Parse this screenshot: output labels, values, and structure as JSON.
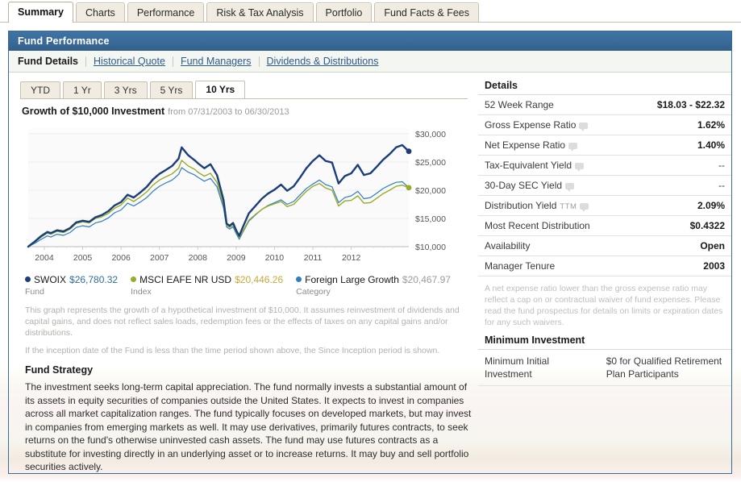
{
  "tabs": [
    {
      "label": "Summary",
      "active": true
    },
    {
      "label": "Charts",
      "active": false
    },
    {
      "label": "Performance",
      "active": false
    },
    {
      "label": "Risk & Tax Analysis",
      "active": false
    },
    {
      "label": "Portfolio",
      "active": false
    },
    {
      "label": "Fund Facts & Fees",
      "active": false
    }
  ],
  "panel": {
    "title": "Fund Performance",
    "subnav": [
      {
        "label": "Fund Details",
        "current": true
      },
      {
        "label": "Historical Quote",
        "current": false
      },
      {
        "label": "Fund Managers",
        "current": false
      },
      {
        "label": "Dividends & Distributions",
        "current": false
      }
    ]
  },
  "periods": [
    {
      "label": "YTD",
      "active": false
    },
    {
      "label": "1 Yr",
      "active": false
    },
    {
      "label": "3 Yrs",
      "active": false
    },
    {
      "label": "5 Yrs",
      "active": false
    },
    {
      "label": "10 Yrs",
      "active": true
    }
  ],
  "chart_header": {
    "title": "Growth of $10,000 Investment",
    "range": "from 07/31/2003 to 06/30/2013"
  },
  "legend": [
    {
      "name": "SWOIX",
      "value": "$26,780.32",
      "sub": "Fund",
      "color": "#1b3d7a",
      "value_color": "#2e6da4"
    },
    {
      "name": "MSCI EAFE NR USD",
      "value": "$20,446.26",
      "sub": "Index",
      "color": "#9aab29",
      "value_color": "#c5a93b"
    },
    {
      "name": "Foreign Large Growth",
      "value": "$20,467.97",
      "sub": "Category",
      "color": "#2f7ec4",
      "value_color": "#9b9b9b"
    }
  ],
  "graph_disclaimer": [
    "This graph represents the growth of a hypothetical investment of $10,000. It assumes reinvestment of dividends and capital gains, and does not reflect sales loads, redemption fees or the effects of taxes on any capital gains and/or distributions.",
    "If the inception date of the Fund is less than the time period shown above, the Since Inception period is shown."
  ],
  "strategy": {
    "title": "Fund Strategy",
    "text": "The investment seeks long-term capital appreciation. The fund normally invests a substantial amount of its assets in equity securities of companies outside the United States. It expects to invest in companies across all market capitalization ranges. The fund typically focuses on developed markets, but may invest in companies from emerging markets as well. It may use derivatives, primarily futures contracts, to seek returns on the fund's otherwise uninvested cash assets. The fund may use futures contracts as a substitute for investing directly in an underlying asset or to increase returns. It may buy and sell portfolio securities actively."
  },
  "details": {
    "title": "Details",
    "rows": [
      {
        "label": "52 Week Range",
        "value": "$18.03 - $22.32",
        "info": false,
        "bold": true
      },
      {
        "label": "Gross Expense Ratio",
        "value": "1.62%",
        "info": true,
        "bold": true
      },
      {
        "label": "Net Expense Ratio",
        "value": "1.40%",
        "info": true,
        "bold": true
      },
      {
        "label": "Tax-Equivalent Yield",
        "value": "--",
        "info": true,
        "bold": false
      },
      {
        "label": "30-Day SEC Yield",
        "value": "--",
        "info": true,
        "bold": false
      },
      {
        "label": "Distribution Yield",
        "suffix": "TTM",
        "value": "2.09%",
        "info": true,
        "bold": true
      },
      {
        "label": "Most Recent Distribution",
        "value": "$0.4322",
        "info": false,
        "bold": true
      },
      {
        "label": "Availability",
        "value": "Open",
        "info": false,
        "bold": true
      },
      {
        "label": "Manager Tenure",
        "value": "2003",
        "info": false,
        "bold": true
      }
    ],
    "note": "A net expense ratio lower than the gross expense ratio may reflect a cap on or contractual waiver of fund expenses. Please read the fund prospectus for details on limits or expiration dates for any such waivers."
  },
  "minimum_investment": {
    "title": "Minimum Investment",
    "rows": [
      {
        "label": "Minimum Initial Investment",
        "value": "$0 for Qualified Retirement Plan Participants"
      }
    ]
  },
  "chart_data": {
    "type": "line",
    "title": "Growth of $10,000 Investment",
    "subtitle": "from 07/31/2003 to 06/30/2013",
    "xlabel": "",
    "ylabel": "",
    "grid": true,
    "legend_position": "bottom",
    "xlim": [
      2003.58,
      2013.5
    ],
    "ylim": [
      10000,
      31000
    ],
    "ytick_values": [
      10000,
      15000,
      20000,
      25000,
      30000
    ],
    "ytick_labels": [
      "$10,000",
      "$15,000",
      "$20,000",
      "$25,000",
      "$30,000"
    ],
    "xtick_values": [
      2004,
      2005,
      2006,
      2007,
      2008,
      2009,
      2010,
      2011,
      2012
    ],
    "xtick_labels": [
      "2004",
      "2005",
      "2006",
      "2007",
      "2008",
      "2009",
      "2010",
      "2011",
      "2012"
    ],
    "series": [
      {
        "name": "SWOIX",
        "role": "Fund",
        "color": "#1b3d7a",
        "width": 2.4,
        "end_value": 26780.32,
        "x": [
          2003.58,
          2003.75,
          2003.92,
          2004.08,
          2004.17,
          2004.33,
          2004.5,
          2004.67,
          2004.83,
          2005.0,
          2005.17,
          2005.33,
          2005.5,
          2005.67,
          2005.83,
          2006.0,
          2006.17,
          2006.33,
          2006.5,
          2006.67,
          2006.83,
          2007.0,
          2007.17,
          2007.33,
          2007.5,
          2007.58,
          2007.75,
          2007.92,
          2008.0,
          2008.17,
          2008.33,
          2008.5,
          2008.67,
          2008.75,
          2008.83,
          2008.92,
          2009.0,
          2009.08,
          2009.17,
          2009.33,
          2009.5,
          2009.67,
          2009.83,
          2010.0,
          2010.17,
          2010.33,
          2010.5,
          2010.67,
          2010.83,
          2011.0,
          2011.17,
          2011.33,
          2011.5,
          2011.67,
          2011.83,
          2012.0,
          2012.17,
          2012.33,
          2012.5,
          2012.67,
          2012.83,
          2013.0,
          2013.17,
          2013.33,
          2013.5
        ],
        "y": [
          10000,
          10900,
          11900,
          12600,
          12400,
          12900,
          12700,
          13300,
          14300,
          14600,
          14400,
          15200,
          15600,
          16300,
          17300,
          17900,
          19200,
          18700,
          19600,
          20600,
          21900,
          22900,
          23600,
          24300,
          25600,
          27600,
          26200,
          25300,
          24800,
          23900,
          24600,
          22700,
          18300,
          14100,
          13700,
          14200,
          12900,
          11900,
          13400,
          15900,
          17200,
          18500,
          19400,
          20100,
          21000,
          19900,
          20700,
          22300,
          23900,
          25200,
          26200,
          25200,
          24900,
          21200,
          22500,
          23000,
          24500,
          22700,
          23000,
          24200,
          25400,
          26400,
          27600,
          28000,
          26900
        ]
      },
      {
        "name": "MSCI EAFE NR USD",
        "role": "Index",
        "color": "#9aab29",
        "width": 1.4,
        "end_value": 20446.26,
        "x": [
          2003.58,
          2003.75,
          2003.92,
          2004.08,
          2004.17,
          2004.33,
          2004.5,
          2004.67,
          2004.83,
          2005.0,
          2005.17,
          2005.33,
          2005.5,
          2005.67,
          2005.83,
          2006.0,
          2006.17,
          2006.33,
          2006.5,
          2006.67,
          2006.83,
          2007.0,
          2007.17,
          2007.33,
          2007.5,
          2007.58,
          2007.75,
          2007.92,
          2008.0,
          2008.17,
          2008.33,
          2008.5,
          2008.67,
          2008.75,
          2008.83,
          2008.92,
          2009.0,
          2009.08,
          2009.17,
          2009.33,
          2009.5,
          2009.67,
          2009.83,
          2010.0,
          2010.17,
          2010.33,
          2010.5,
          2010.67,
          2010.83,
          2011.0,
          2011.17,
          2011.33,
          2011.5,
          2011.67,
          2011.83,
          2012.0,
          2012.17,
          2012.33,
          2012.5,
          2012.67,
          2012.83,
          2013.0,
          2013.17,
          2013.33,
          2013.5
        ],
        "y": [
          10000,
          10800,
          11700,
          12400,
          12200,
          12700,
          12500,
          13100,
          14100,
          14400,
          14200,
          15000,
          15300,
          15900,
          16800,
          17400,
          18600,
          18000,
          18800,
          19700,
          20900,
          21800,
          22400,
          22900,
          23900,
          25300,
          24300,
          23700,
          23200,
          22500,
          23000,
          21400,
          17500,
          13800,
          13400,
          13800,
          12600,
          11600,
          12700,
          14700,
          15700,
          16600,
          17200,
          17600,
          18000,
          17100,
          17500,
          18700,
          19800,
          20700,
          21200,
          20400,
          20000,
          17200,
          18100,
          18200,
          19000,
          17700,
          17800,
          18600,
          19400,
          20000,
          20700,
          20900,
          20450
        ]
      },
      {
        "name": "Foreign Large Growth",
        "role": "Category",
        "color": "#2f7ec4",
        "width": 1.2,
        "end_value": 20467.97,
        "x": [
          2003.58,
          2003.75,
          2003.92,
          2004.08,
          2004.17,
          2004.33,
          2004.5,
          2004.67,
          2004.83,
          2005.0,
          2005.17,
          2005.33,
          2005.5,
          2005.67,
          2005.83,
          2006.0,
          2006.17,
          2006.33,
          2006.5,
          2006.67,
          2006.83,
          2007.0,
          2007.17,
          2007.33,
          2007.5,
          2007.58,
          2007.75,
          2007.92,
          2008.0,
          2008.17,
          2008.33,
          2008.5,
          2008.67,
          2008.75,
          2008.83,
          2008.92,
          2009.0,
          2009.08,
          2009.17,
          2009.33,
          2009.5,
          2009.67,
          2009.83,
          2010.0,
          2010.17,
          2010.33,
          2010.5,
          2010.67,
          2010.83,
          2011.0,
          2011.17,
          2011.33,
          2011.5,
          2011.67,
          2011.83,
          2012.0,
          2012.17,
          2012.33,
          2012.5,
          2012.67,
          2012.83,
          2013.0,
          2013.17,
          2013.33,
          2013.5
        ],
        "y": [
          10000,
          10600,
          11300,
          11900,
          11700,
          12200,
          12000,
          12500,
          13400,
          13700,
          13500,
          14200,
          14500,
          15100,
          16000,
          16500,
          17700,
          17200,
          17900,
          18700,
          19800,
          20700,
          21300,
          21800,
          22800,
          24000,
          23200,
          22700,
          22300,
          21600,
          22100,
          20600,
          16900,
          13500,
          13100,
          13500,
          12300,
          11300,
          12500,
          14500,
          15600,
          16600,
          17300,
          17800,
          18300,
          17500,
          18000,
          19200,
          20300,
          21100,
          21800,
          21000,
          20600,
          17800,
          18700,
          19000,
          19800,
          18500,
          18700,
          19500,
          20300,
          20900,
          21400,
          21500,
          20468
        ]
      }
    ]
  }
}
